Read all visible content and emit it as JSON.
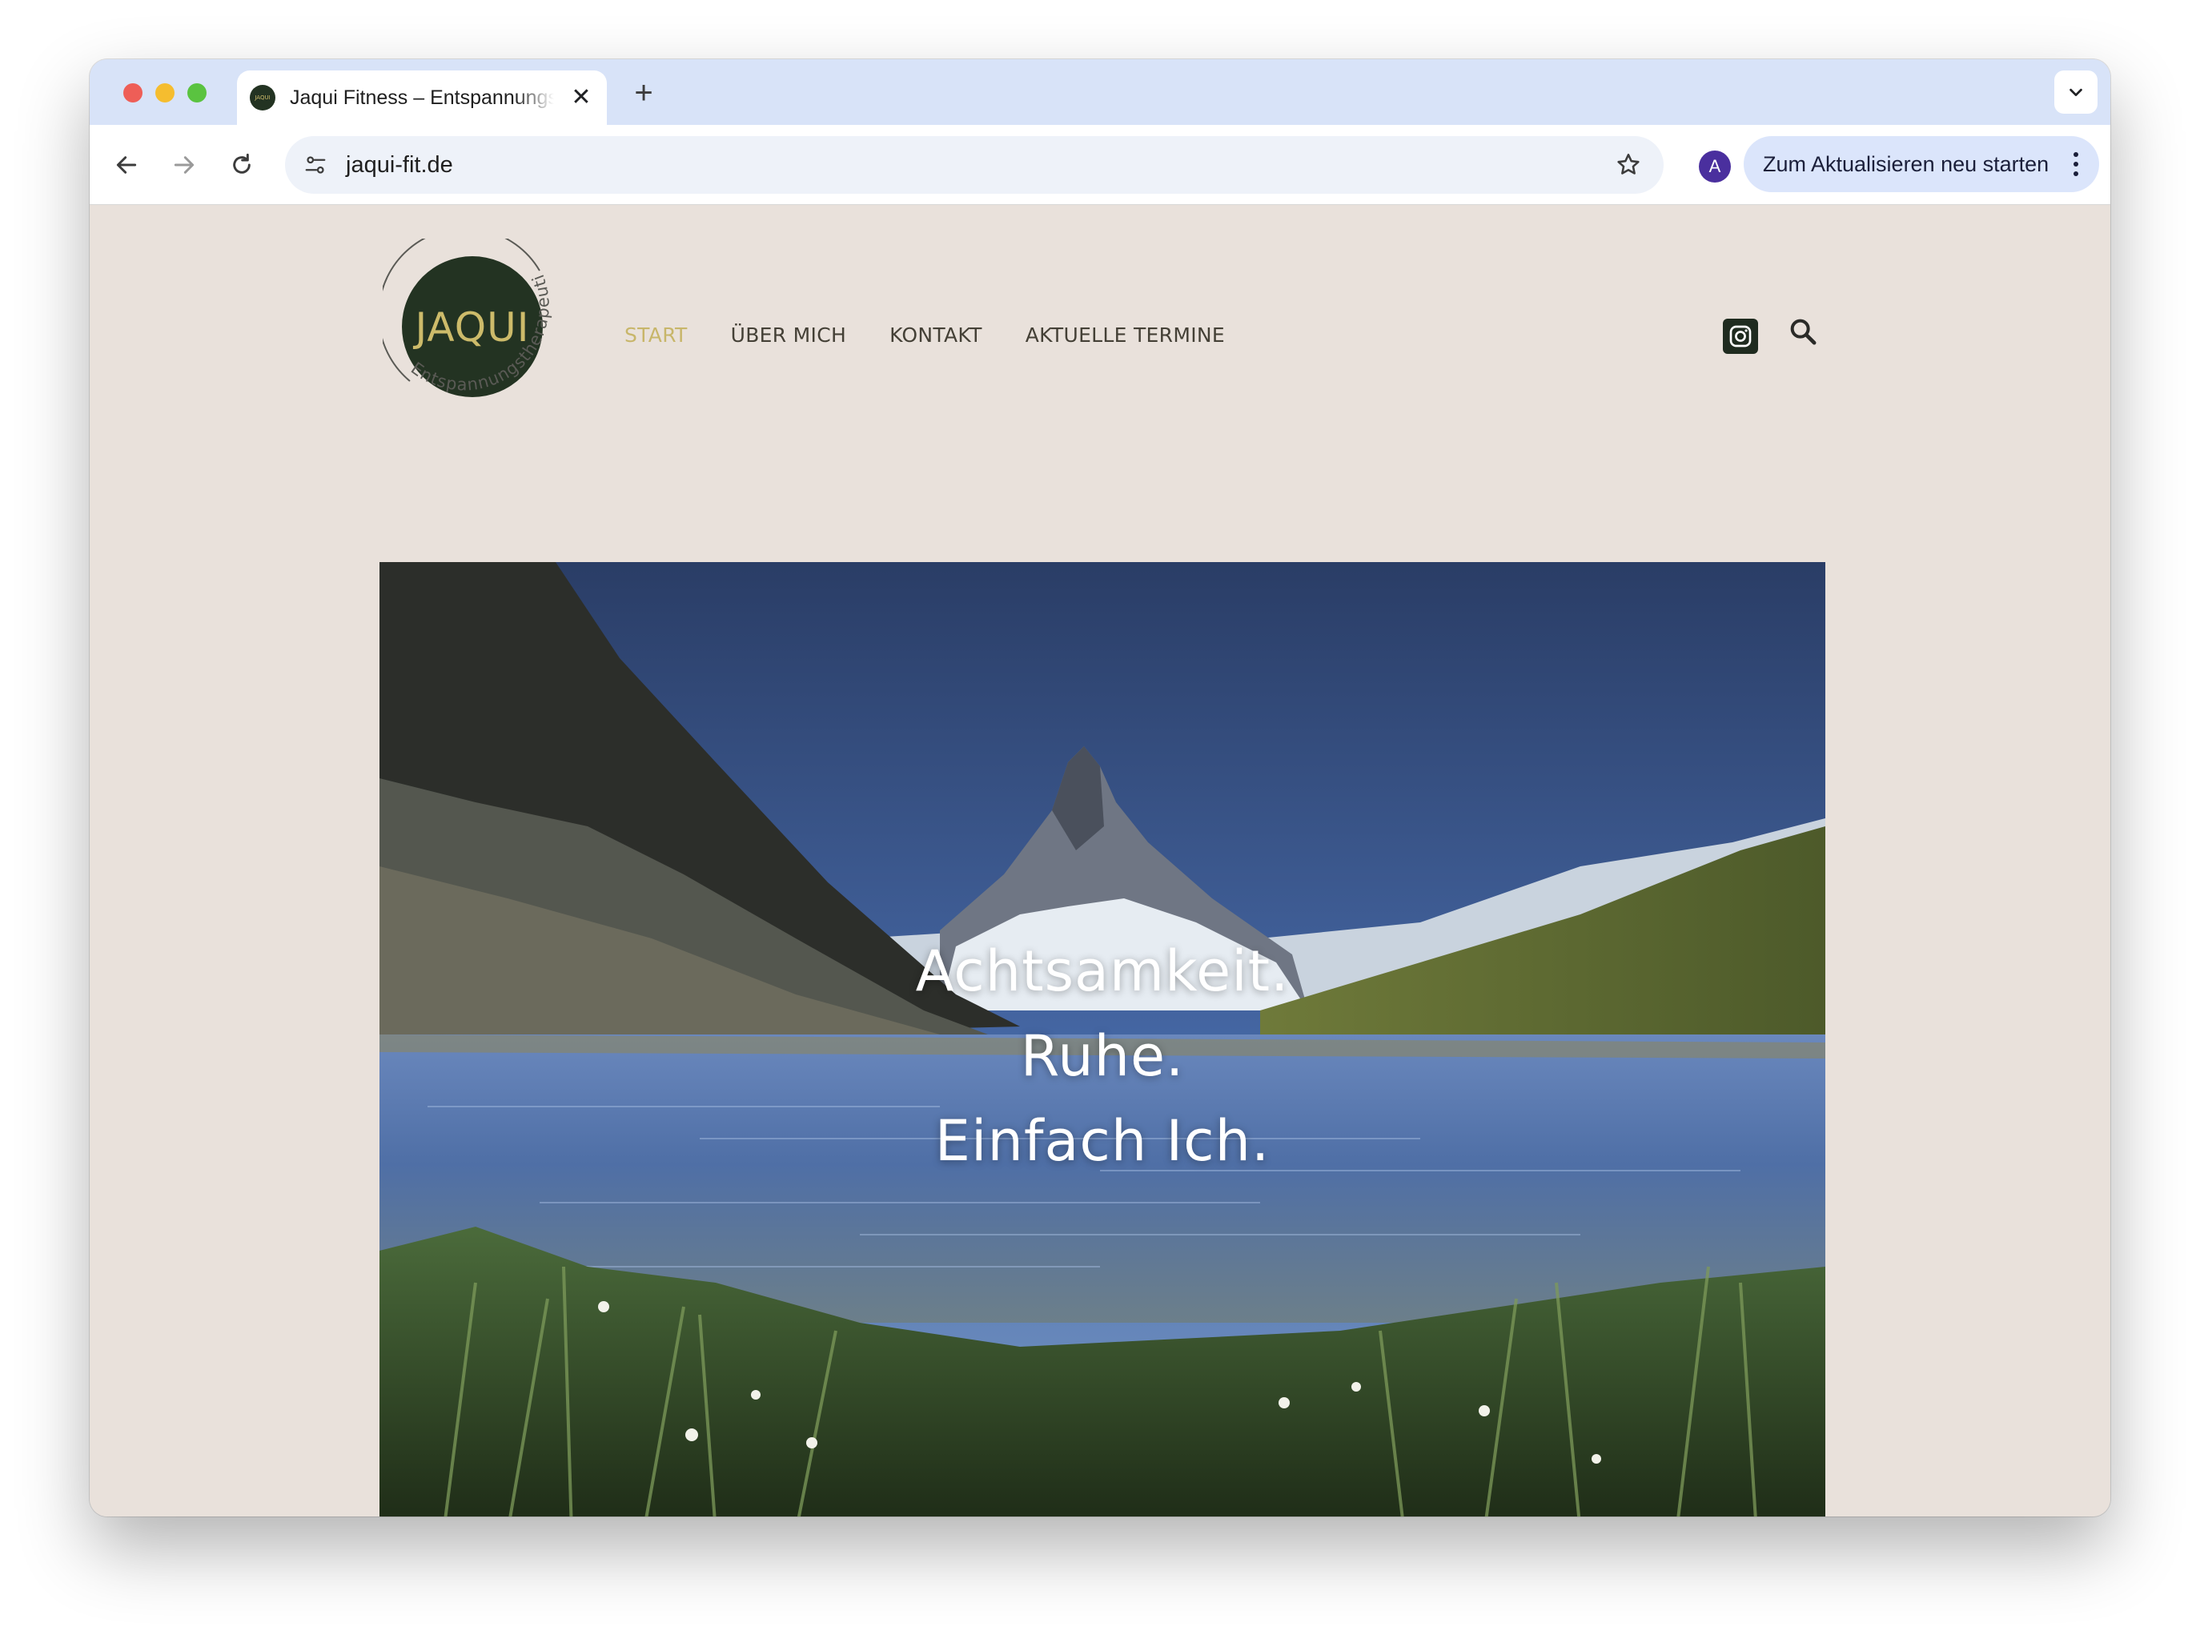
{
  "browser": {
    "tab_title": "Jaqui Fitness – Entspannungstherapeutin",
    "tab_favicon_text": "JAQUI",
    "close_glyph": "✕",
    "new_tab_glyph": "+",
    "url": "jaqui-fit.de",
    "avatar_letter": "A",
    "restart_label": "Zum Aktualisieren neu starten"
  },
  "site": {
    "logo": {
      "word": "JAQUI",
      "ring_text": "Entspannungstherapeutin",
      "colors": {
        "disc": "#233322",
        "word": "#cdbb6a",
        "ring": "#5a5a55"
      }
    },
    "nav": [
      {
        "label": "START",
        "active": true
      },
      {
        "label": "ÜBER MICH",
        "active": false
      },
      {
        "label": "KONTAKT",
        "active": false
      },
      {
        "label": "AKTUELLE TERMINE",
        "active": false
      }
    ],
    "icons": [
      "instagram-icon",
      "search-icon"
    ],
    "accent_color": "#c8b66a"
  },
  "hero": {
    "lines": [
      "Achtsamkeit.",
      "Ruhe.",
      "Einfach Ich."
    ]
  }
}
